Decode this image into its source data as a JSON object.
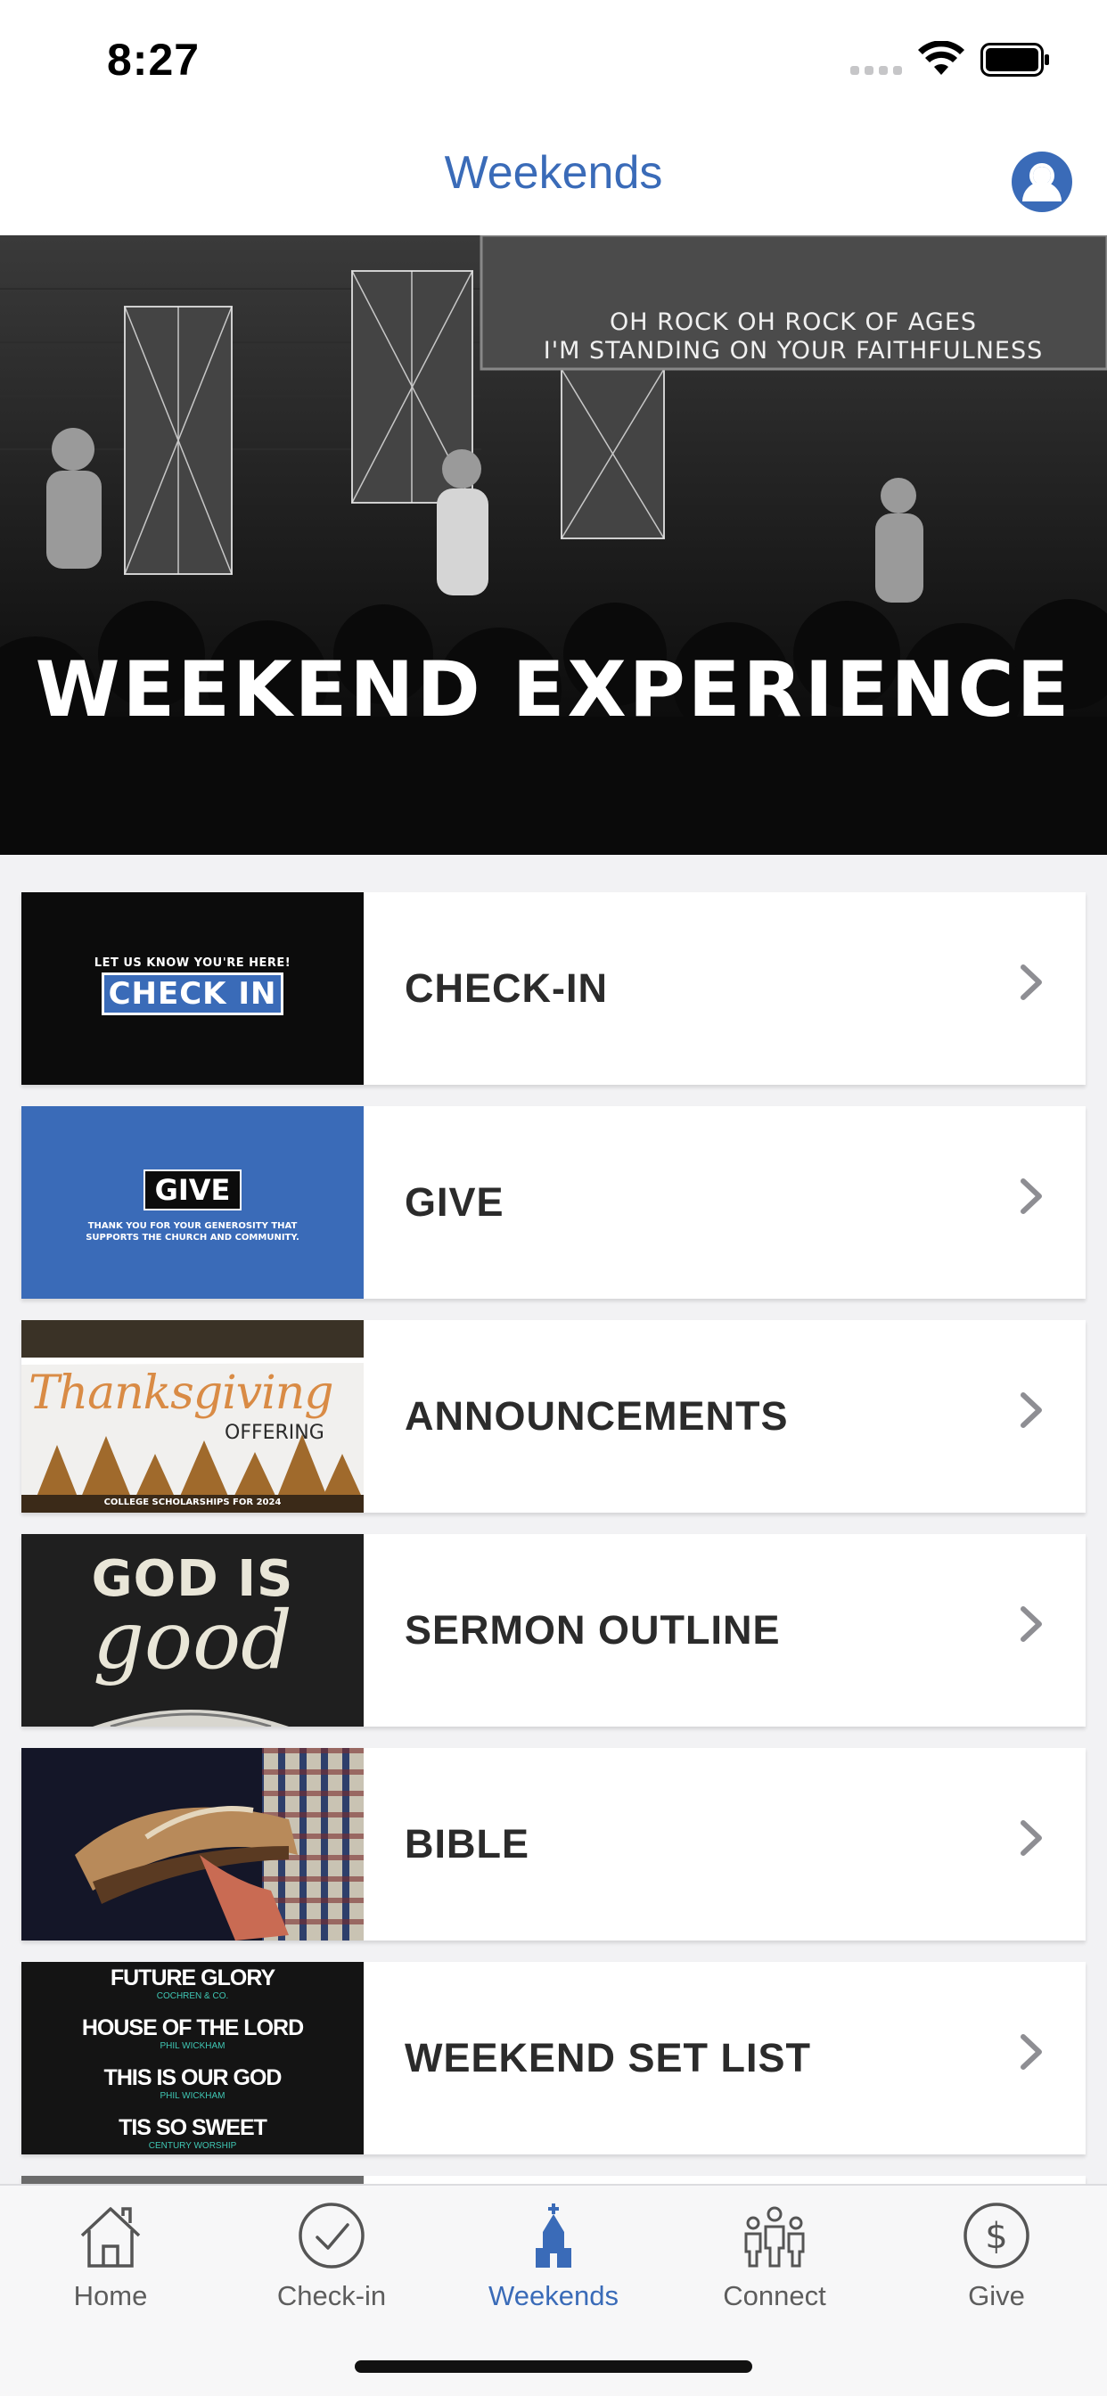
{
  "status_bar": {
    "time": "8:27"
  },
  "header": {
    "title": "Weekends",
    "accent_color": "#3a6bb8"
  },
  "hero": {
    "title": "WEEKEND EXPERIENCE",
    "lyric_line_1": "OH ROCK OH ROCK OF AGES",
    "lyric_line_2": "I'M STANDING ON YOUR FAITHFULNESS"
  },
  "list": {
    "items": [
      {
        "label": "CHECK-IN",
        "thumb_small": "LET US KNOW YOU'RE HERE!",
        "thumb_big": "CHECK IN"
      },
      {
        "label": "GIVE",
        "thumb_big": "GIVE",
        "thumb_small": "THANK YOU FOR YOUR GENEROSITY THAT SUPPORTS THE CHURCH AND COMMUNITY."
      },
      {
        "label": "ANNOUNCEMENTS",
        "thumb_script": "Thanksgiving",
        "thumb_big": "OFFERING",
        "thumb_small": "COLLEGE SCHOLARSHIPS FOR 2024"
      },
      {
        "label": "SERMON OUTLINE",
        "thumb_big": "GOD IS",
        "thumb_script": "good"
      },
      {
        "label": "BIBLE"
      },
      {
        "label": "WEEKEND SET LIST",
        "songs": [
          {
            "title": "FUTURE GLORY",
            "artist": "COCHREN & CO."
          },
          {
            "title": "HOUSE OF THE LORD",
            "artist": "PHIL WICKHAM"
          },
          {
            "title": "THIS IS OUR GOD",
            "artist": "PHIL WICKHAM"
          },
          {
            "title": "TIS SO SWEET",
            "artist": "CENTURY WORSHIP"
          }
        ]
      }
    ]
  },
  "tabbar": {
    "tabs": [
      {
        "label": "Home",
        "icon": "house-icon"
      },
      {
        "label": "Check-in",
        "icon": "checkmark-circle-icon"
      },
      {
        "label": "Weekends",
        "icon": "church-icon",
        "active": true
      },
      {
        "label": "Connect",
        "icon": "people-icon"
      },
      {
        "label": "Give",
        "icon": "dollar-circle-icon"
      }
    ]
  }
}
